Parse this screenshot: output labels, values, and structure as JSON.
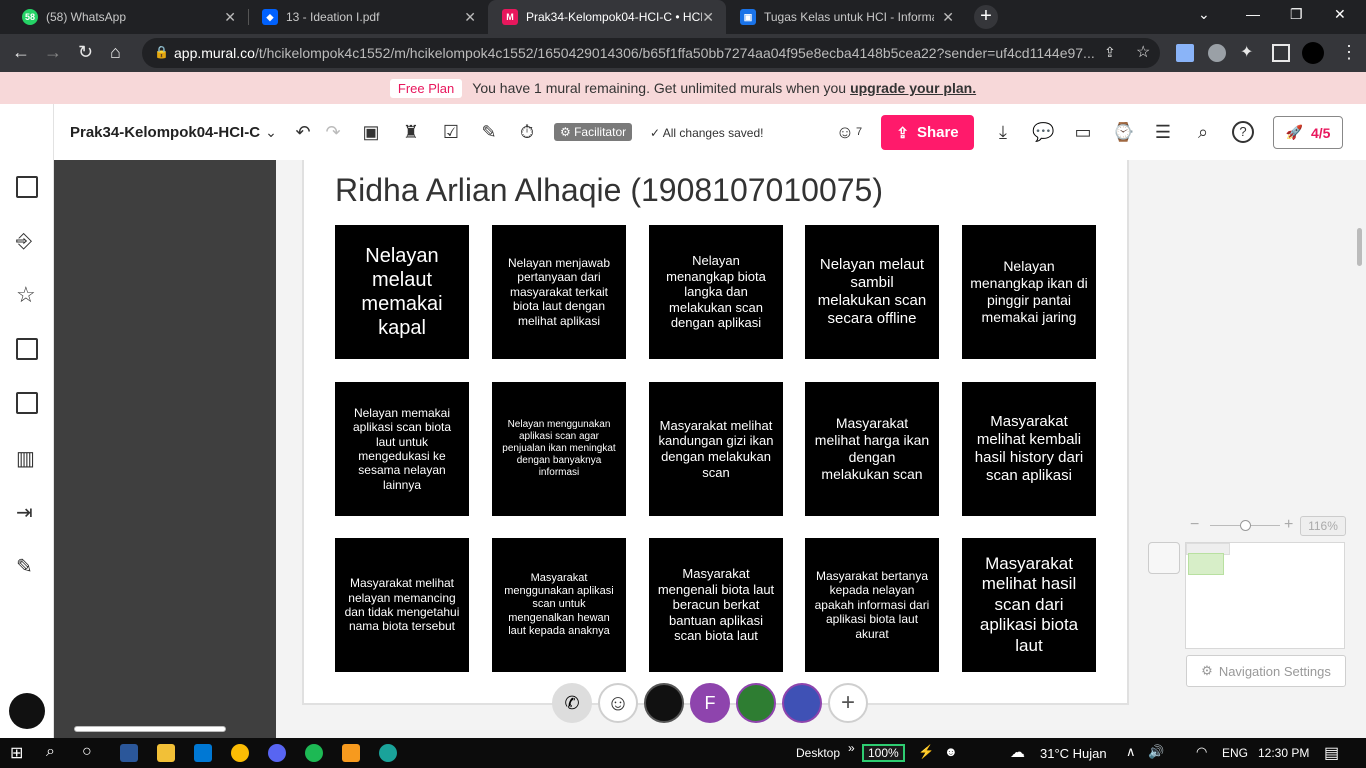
{
  "browser": {
    "tabs": [
      {
        "title": "(58) WhatsApp",
        "badge": "58",
        "color": "#25d366",
        "active": false
      },
      {
        "title": "13 - Ideation I.pdf",
        "color": "#0061fe",
        "active": false
      },
      {
        "title": "Prak34-Kelompok04-HCI-C • HCI",
        "color": "#e8175d",
        "badge": "M",
        "active": true
      },
      {
        "title": "Tugas Kelas untuk HCI - Informat",
        "color": "#1a73e8",
        "active": false
      }
    ],
    "url_host": "app.mural.co",
    "url_path": "/t/hcikelompok4c1552/m/hcikelompok4c1552/1650429014306/b65f1ffa50bb7274aa04f95e8ecba4148b5cea22?sender=uf4cd1144e97..."
  },
  "banner": {
    "plan": "Free Plan",
    "message": "You have 1 mural remaining. Get unlimited murals when you",
    "link": "upgrade your plan."
  },
  "header": {
    "title": "Prak34-Kelompok04-HCI-C",
    "facilitator": "Facilitator",
    "saved": "All changes saved!",
    "users": "7",
    "share": "Share",
    "progress": "4/5"
  },
  "board": {
    "name": "Ridha Arlian Alhaqie (1908107010075)",
    "stickies": [
      "Nelayan melaut memakai kapal",
      "Nelayan menjawab pertanyaan dari masyarakat terkait biota laut dengan melihat aplikasi",
      "Nelayan menangkap biota langka dan melakukan scan dengan aplikasi",
      "Nelayan melaut sambil melakukan scan secara offline",
      "Nelayan menangkap ikan di pinggir pantai memakai jaring",
      "Nelayan memakai aplikasi scan biota laut untuk mengedukasi ke sesama nelayan lainnya",
      "Nelayan menggunakan aplikasi scan agar penjualan ikan meningkat dengan banyaknya informasi",
      "Masyarakat melihat kandungan gizi ikan dengan melakukan scan",
      "Masyarakat melihat harga ikan dengan melakukan scan",
      "Masyarakat melihat kembali hasil history dari scan aplikasi",
      "Masyarakat melihat nelayan memancing dan tidak mengetahui nama biota tersebut",
      "Masyarakat menggunakan aplikasi scan untuk mengenalkan hewan laut kepada anaknya",
      "Masyarakat mengenali biota laut beracun berkat bantuan aplikasi scan biota laut",
      "Masyarakat bertanya kepada nelayan apakah informasi dari aplikasi biota laut akurat",
      "Masyarakat melihat hasil scan dari aplikasi biota laut"
    ]
  },
  "collaborators": {
    "f_initial": "F"
  },
  "navigation": {
    "zoom": "116%",
    "settings": "Navigation Settings"
  },
  "taskbar": {
    "desktop": "Desktop",
    "battery": "100%",
    "weather": "31°C  Hujan",
    "lang": "ENG",
    "time": "12:30 PM"
  }
}
